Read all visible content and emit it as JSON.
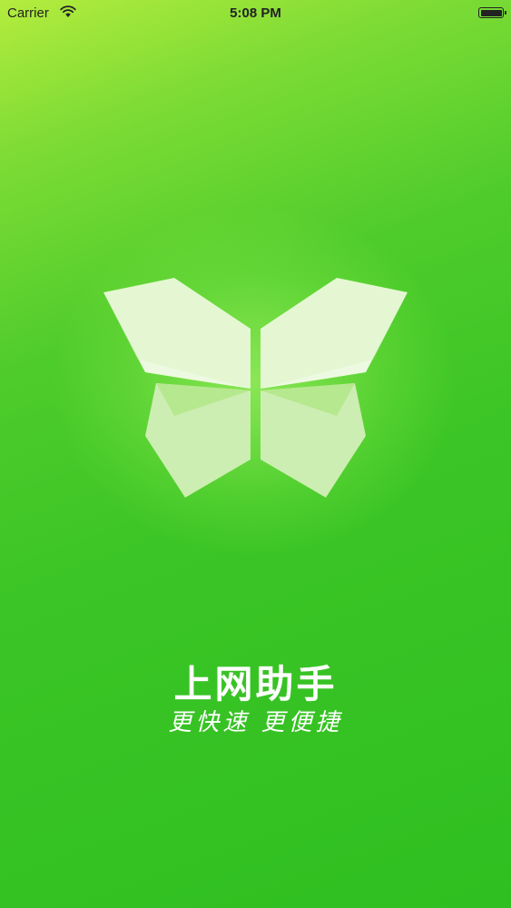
{
  "status_bar": {
    "carrier": "Carrier",
    "time": "5:08 PM",
    "wifi_icon": "wifi-icon",
    "battery_icon": "battery-icon"
  },
  "splash": {
    "logo_icon": "butterfly-icon",
    "title": "上网助手",
    "slogan": "更快速 更便捷"
  },
  "colors": {
    "background_top": "#b5ec3e",
    "background_bottom": "#2fbf20",
    "text": "#ffffff"
  }
}
